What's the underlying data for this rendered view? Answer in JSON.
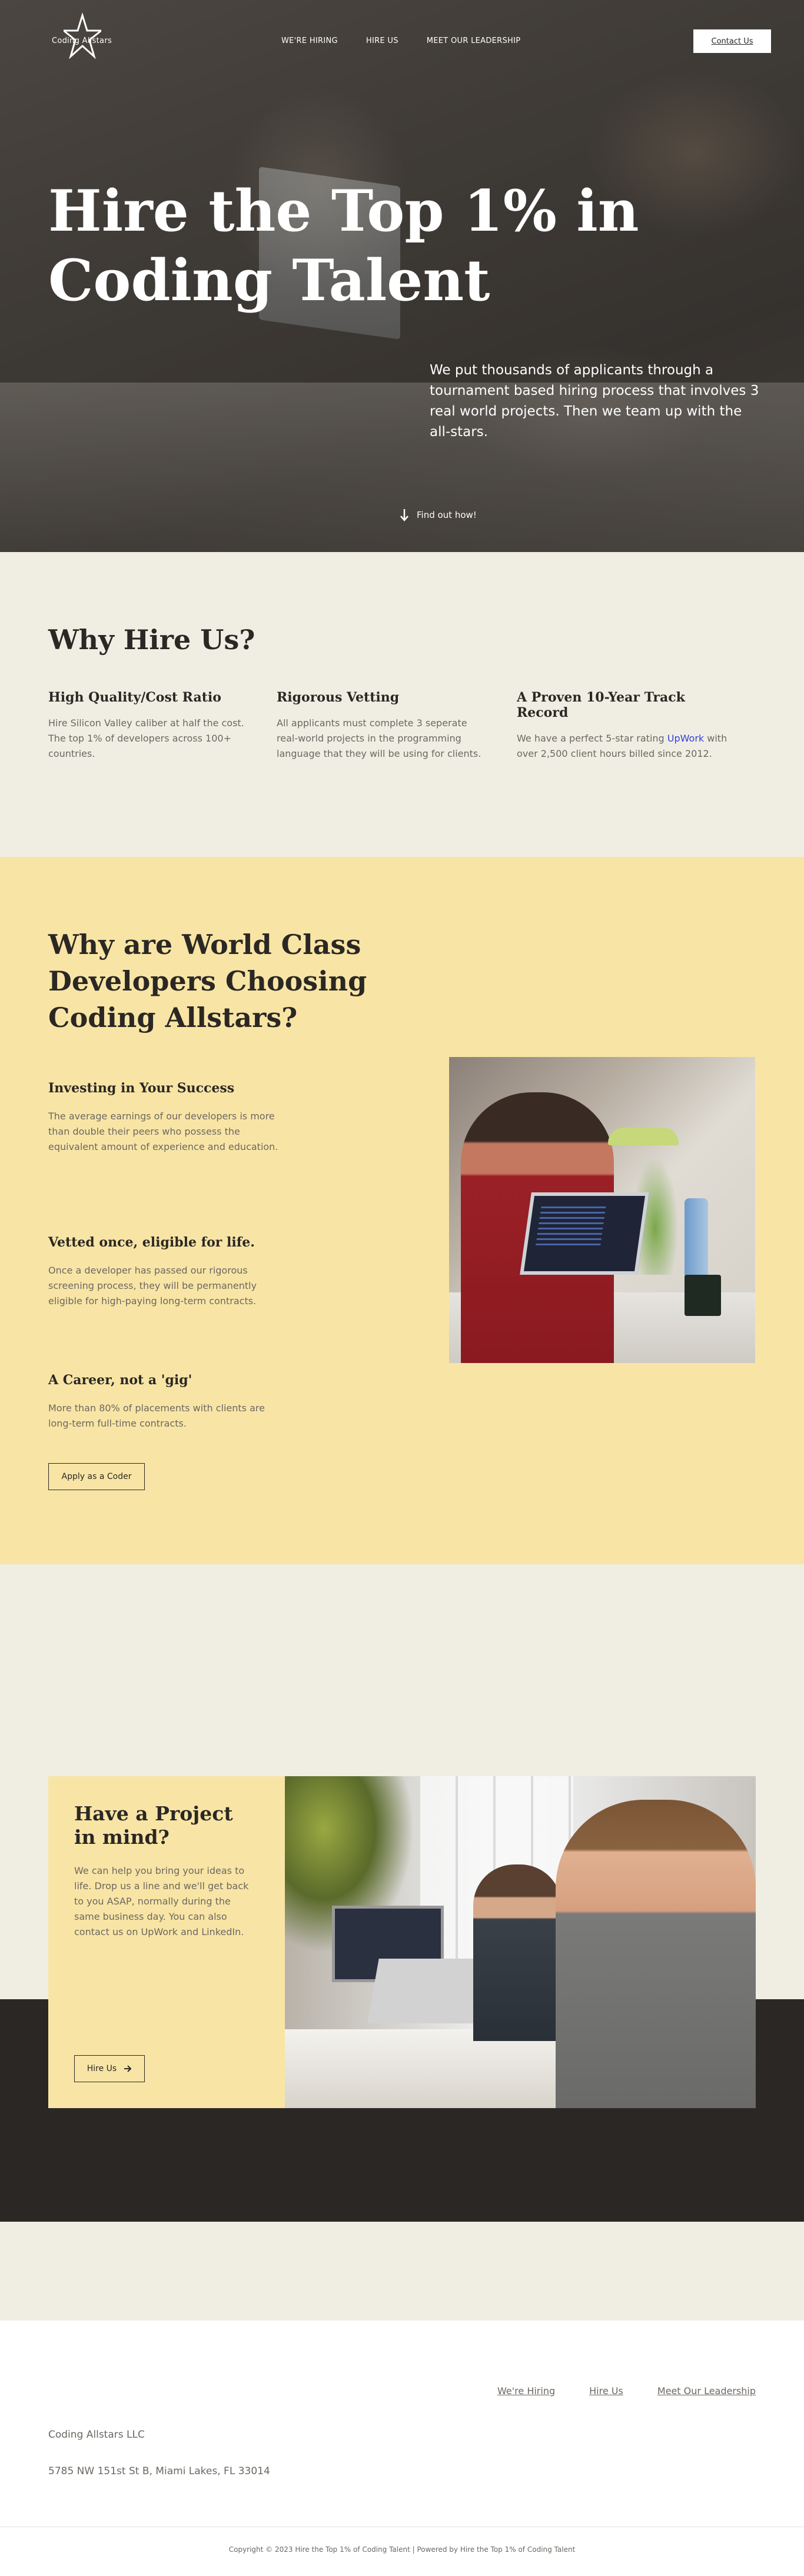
{
  "brand": {
    "logo_text": "Coding Allstars"
  },
  "nav": {
    "items": [
      {
        "label": "WE'RE HIRING"
      },
      {
        "label": "HIRE US"
      },
      {
        "label": "MEET OUR LEADERSHIP"
      }
    ],
    "contact_label": "Contact Us"
  },
  "hero": {
    "title": "Hire the Top 1% in Coding Talent",
    "subtitle": "We put thousands of applicants through a tournament based hiring process that involves 3 real world projects. Then we team up with the all-stars.",
    "find_out": "Find out how!"
  },
  "why_hire": {
    "heading": "Why Hire Us?",
    "columns": [
      {
        "title": "High Quality/Cost Ratio",
        "text": "Hire Silicon Valley caliber at half the cost. The top 1% of developers across 100+ countries."
      },
      {
        "title": "Rigorous Vetting",
        "text": "All applicants must complete 3 seperate real-world projects in the programming language that they will be using for clients."
      },
      {
        "title": "A Proven 10-Year Track Record",
        "text_before": "We have a perfect 5-star rating ",
        "link": "UpWork",
        "text_after": " with over 2,500 client hours billed since 2012."
      }
    ]
  },
  "world_class": {
    "heading": "Why are World Class Developers Choosing Coding Allstars?",
    "features": [
      {
        "title": "Investing in Your Success",
        "text": "The average earnings of our developers is more than double their peers who possess the equivalent amount of experience and education."
      },
      {
        "title": "Vetted once, eligible for life.",
        "text": "Once a developer has passed our rigorous screening process, they will be permanently eligible for high-paying long-term contracts."
      },
      {
        "title": "A Career, not a 'gig'",
        "text": "More than 80% of placements with clients are long-term full-time contracts."
      }
    ],
    "apply_label": "Apply as a Coder"
  },
  "project": {
    "heading": "Have a Project in mind?",
    "text": "We can help you bring your ideas to life. Drop us a line and we'll get back to you ASAP, normally during the same business day. You can also contact us on UpWork and LinkedIn.",
    "button_label": "Hire Us"
  },
  "footer": {
    "links": [
      {
        "label": "We're Hiring"
      },
      {
        "label": "Hire Us"
      },
      {
        "label": "Meet Our Leadership"
      }
    ],
    "company": "Coding Allstars LLC",
    "address": "5785 NW 151st St B, Miami Lakes, FL 33014",
    "copyright": "Copyright © 2023 Hire the Top 1% of Coding Talent | Powered by Hire the Top 1% of Coding Talent"
  }
}
